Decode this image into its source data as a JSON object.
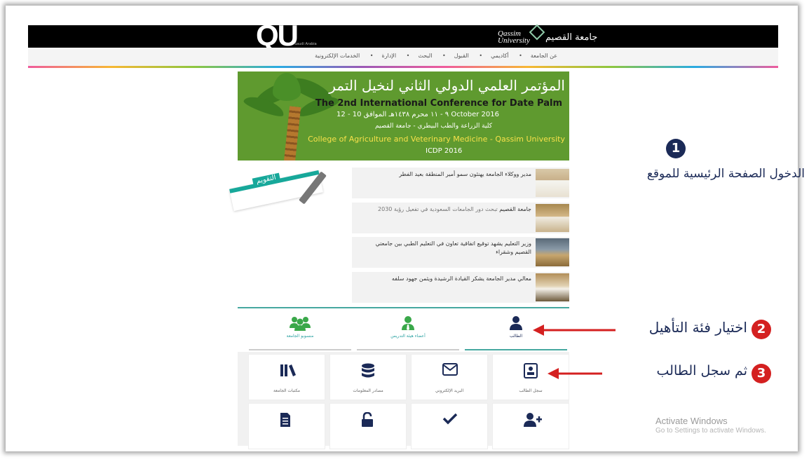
{
  "header": {
    "logo_text": "QU",
    "logo_small": "Saudi Arabia",
    "university_en_1": "Qassim",
    "university_en_2": "University",
    "university_ar": "جامعة القصيم"
  },
  "nav": {
    "items": [
      "عن الجامعة",
      "أكاديمي",
      "القبول",
      "البحث",
      "الإدارة",
      "الخدمات الإلكترونية"
    ],
    "separator": "•"
  },
  "banner": {
    "ar_title": "المؤتمر العلمي الدولي الثاني لنخيل التمر",
    "en_title": "The 2nd International Conference for Date Palm",
    "dates": "٩ - ١١ محرم ١٤٣٨هـ الموافق 10 - 12 October 2016",
    "college_ar": "كلية الزراعة والطب البيطري - جامعة القصيم",
    "college_en": "College of Agriculture and Veterinary Medicine - Qassim University",
    "code": "ICDP 2016"
  },
  "calendar": {
    "label": "التقويم"
  },
  "news": [
    {
      "bold": "مدير ووكلاء الجامعة يهنئون سمو أمير المنطقة بعيد الفطر",
      "rest": ""
    },
    {
      "bold": "جامعة القصيم",
      "rest": " تبحث دور الجامعات السعودية في تفعيل رؤية 2030"
    },
    {
      "bold": "وزير التعليم يشهد توقيع اتفاقية تعاون في التعليم الطبي بين جامعتي القصيم وشقراء",
      "rest": ""
    },
    {
      "bold": "معالي مدير الجامعة يشكر القيادة الرشيدة ويثمن جهود سلفه",
      "rest": ""
    }
  ],
  "tabs": [
    {
      "label": "الطالب"
    },
    {
      "label": "أعضاء هيئة التدريس"
    },
    {
      "label": "منسوبو الجامعة"
    }
  ],
  "tiles": [
    {
      "label": "سجل الطالب",
      "icon": "student-record-icon"
    },
    {
      "label": "البريد الإلكتروني",
      "icon": "envelope-icon"
    },
    {
      "label": "مصادر المعلومات",
      "icon": "database-icon"
    },
    {
      "label": "مكتبات الجامعة",
      "icon": "library-icon"
    },
    {
      "label": "",
      "icon": "add-user-icon"
    },
    {
      "label": "",
      "icon": "check-icon"
    },
    {
      "label": "",
      "icon": "unlock-icon"
    },
    {
      "label": "",
      "icon": "document-icon"
    }
  ],
  "annotations": {
    "step1_num": "1",
    "step1_text": "الدخول الصفحة الرئيسية للموقع",
    "step2_num": "2",
    "step2_text": "اختيار فئة التأهيل",
    "step3_num": "3",
    "step3_text": "ثم سجل الطالب"
  },
  "watermark": {
    "title": "Activate Windows",
    "subtitle": "Go to Settings to activate Windows."
  },
  "colors": {
    "teal": "#46a8a0",
    "navy": "#1b2a57",
    "annotation_red": "#d42020",
    "banner_green": "#5f9a2f"
  }
}
